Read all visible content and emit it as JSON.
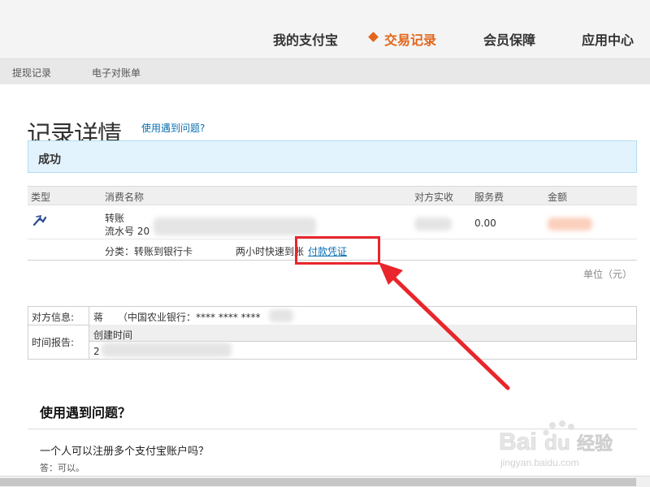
{
  "nav": {
    "items": [
      "我的支付宝",
      "交易记录",
      "会员保障",
      "应用中心"
    ],
    "active": "交易记录"
  },
  "subnav": {
    "items": [
      "提现记录",
      "电子对账单"
    ]
  },
  "page": {
    "title": "记录详情",
    "help_link": "使用遇到问题?",
    "status": "成功"
  },
  "record": {
    "headers": [
      "类型",
      "消费名称",
      "对方实收",
      "服务费",
      "金额"
    ],
    "type_icon": "transfer-icon",
    "name": "转账",
    "serial_prefix": "流水号 20",
    "service_fee": "0.00",
    "category": "分类：转账到银行卡",
    "speed": "两小时快速到账",
    "voucher_link": "付款凭证"
  },
  "unit": "单位（元）",
  "info": {
    "counterparty_label": "对方信息:",
    "counterparty_name": "蒋",
    "counterparty_bank": "（中国农业银行：**** **** ****",
    "time_label": "时间报告:",
    "created_label": "创建时间",
    "created_value": "2"
  },
  "faq": {
    "title": "使用遇到问题？",
    "question": "一个人可以注册多个支付宝账户吗？",
    "answer": "答：可以。"
  },
  "watermark": {
    "text1": "Bai",
    "text2": "du",
    "text3": "经验",
    "url": "jingyan.baidu.com"
  },
  "colors": {
    "accent": "#e2661c",
    "link": "#0b6fb0",
    "status_bg": "#e3f3fd",
    "highlight": "#e8262c"
  }
}
